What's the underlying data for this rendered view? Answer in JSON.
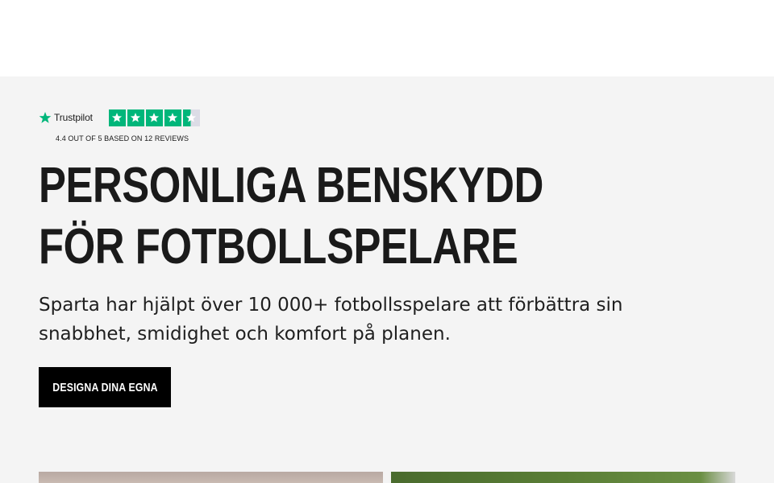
{
  "trustpilot": {
    "brand": "Trustpilot",
    "rating_caption": "4.4 OUT OF 5 BASED ON 12 REVIEWS",
    "rating": 4.4,
    "max_rating": 5,
    "star_color": "#00b67a"
  },
  "hero": {
    "headline": "PERSONLIGA BENSKYDD FÖR FOTBOLLSPELARE",
    "subheadline": "Sparta har hjälpt över 10 000+ fotbollsspelare att förbättra sin snabbhet, smidighet och komfort på planen.",
    "cta_label": "DESIGNA DINA EGNA"
  },
  "colors": {
    "hero_background": "#f4f4f4",
    "cta_background": "#000000",
    "cta_text": "#ffffff"
  }
}
